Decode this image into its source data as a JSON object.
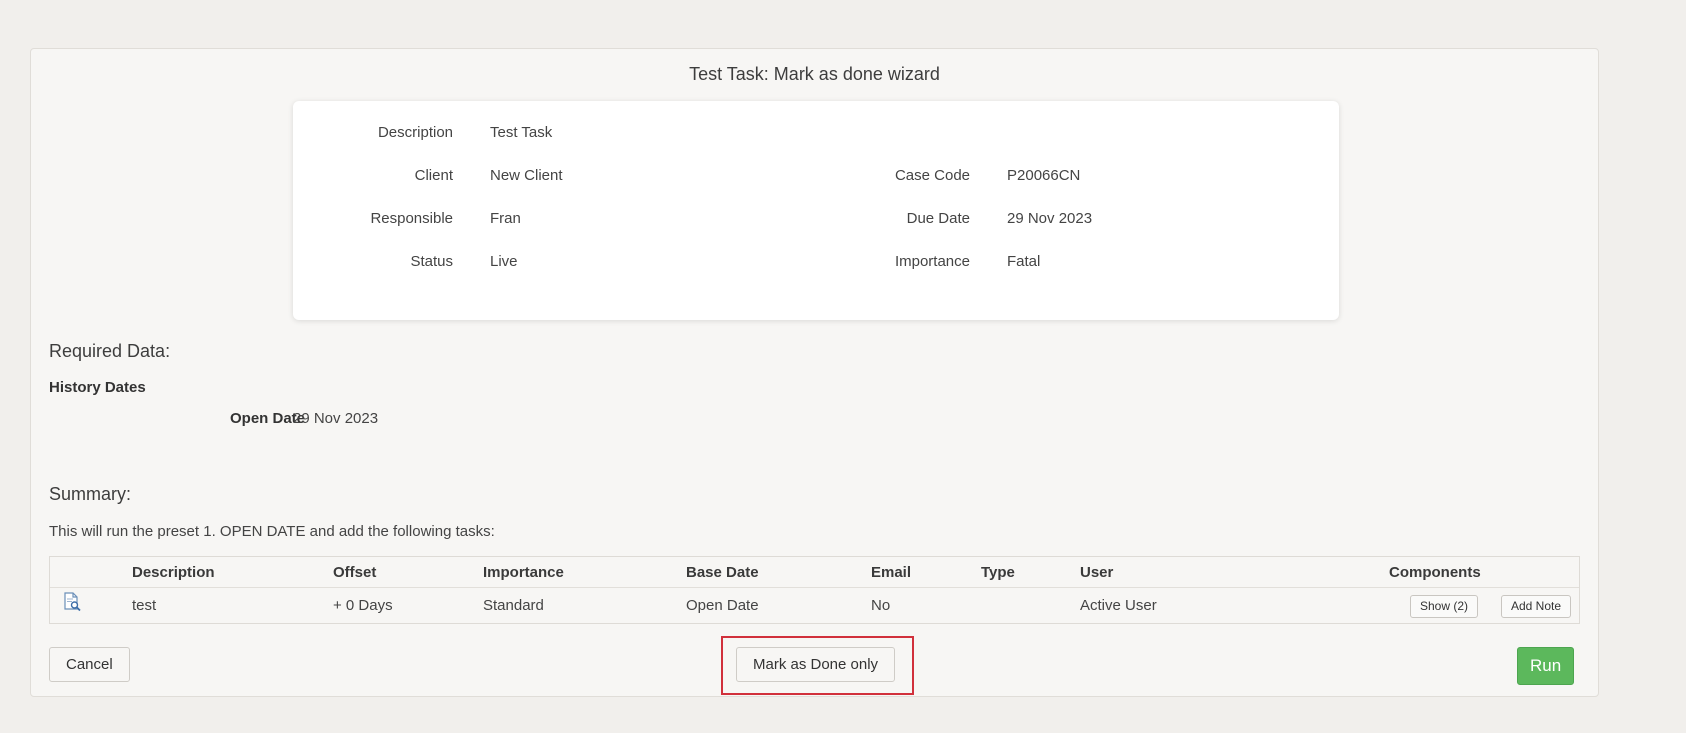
{
  "title": "Test Task: Mark as done wizard",
  "details": {
    "description_label": "Description",
    "description_value": "Test Task",
    "client_label": "Client",
    "client_value": "New Client",
    "case_code_label": "Case Code",
    "case_code_value": "P20066CN",
    "responsible_label": "Responsible",
    "responsible_value": "Fran",
    "due_date_label": "Due Date",
    "due_date_value": "29 Nov 2023",
    "status_label": "Status",
    "status_value": "Live",
    "importance_label": "Importance",
    "importance_value": "Fatal"
  },
  "required_data": {
    "heading": "Required Data:",
    "group_label": "History Dates",
    "open_date_label": "Open Date",
    "open_date_value": "29 Nov 2023"
  },
  "summary": {
    "heading": "Summary:",
    "text": "This will run the preset 1. OPEN DATE and add the following tasks:"
  },
  "table": {
    "columns": [
      "Description",
      "Offset",
      "Importance",
      "Base Date",
      "Email",
      "Type",
      "User",
      "Components"
    ],
    "rows": [
      {
        "icon": "document-search-icon",
        "description": "test",
        "offset": "+ 0 Days",
        "importance": "Standard",
        "base_date": "Open Date",
        "email": "No",
        "type": "",
        "user": "Active User",
        "show_label": "Show (2)",
        "add_note_label": "Add Note"
      }
    ]
  },
  "buttons": {
    "cancel": "Cancel",
    "mark_done_only": "Mark as Done only",
    "run": "Run"
  },
  "colors": {
    "run_button": "#5cb85c",
    "highlight_box": "#d1303b"
  }
}
